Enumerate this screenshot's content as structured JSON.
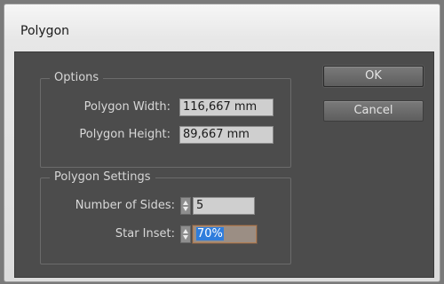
{
  "window": {
    "title": "Polygon"
  },
  "options": {
    "legend": "Options",
    "width_label": "Polygon Width:",
    "width_value": "116,667 mm",
    "height_label": "Polygon Height:",
    "height_value": "89,667 mm"
  },
  "settings": {
    "legend": "Polygon Settings",
    "sides_label": "Number of Sides:",
    "sides_value": "5",
    "inset_label": "Star Inset:",
    "inset_value": "70%"
  },
  "buttons": {
    "ok": "OK",
    "cancel": "Cancel"
  },
  "icons": {
    "stepper": "stepper-up-down-icon"
  },
  "colors": {
    "panel": "#4c4c4c",
    "selection": "#2f7ddc",
    "focus_border": "#b07e56"
  }
}
